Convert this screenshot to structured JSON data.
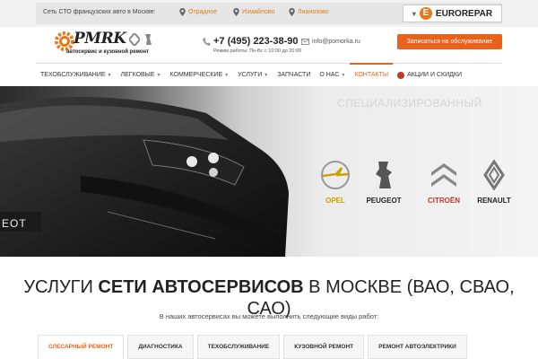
{
  "topbar": {
    "network_text": "Сеть СТО французских авто в Москве:",
    "locations": [
      "Отрадное",
      "Измайлово",
      "Лианозово"
    ],
    "partner": "EUROREPAR",
    "partner_letter": "E"
  },
  "header": {
    "logo_name": "PMRK",
    "logo_sub": "автосервис и кузовной ремонт",
    "phone": "+7 (495) 223-38-90",
    "hours": "Режим работы: Пн-Вс с 10:00 до 20:00",
    "email": "info@pomorka.ru",
    "signup_button": "Записаться на обслуживание"
  },
  "nav": {
    "items": [
      {
        "label": "ТЕХОБСЛУЖИВАНИЕ",
        "dropdown": true
      },
      {
        "label": "ЛЕГКОВЫЕ",
        "dropdown": true
      },
      {
        "label": "КОММЕРЧЕСКИЕ",
        "dropdown": true
      },
      {
        "label": "УСЛУГИ",
        "dropdown": true
      },
      {
        "label": "ЗАПЧАСТИ",
        "dropdown": false
      },
      {
        "label": "О НАС",
        "dropdown": true
      },
      {
        "label": "КОНТАКТЫ",
        "dropdown": false
      }
    ],
    "promo": "АКЦИИ И СКИДКИ",
    "active_index": 6
  },
  "hero": {
    "caption": "СПЕЦИАЛИЗИРОВАННЫЙ",
    "car_badge": "EOT",
    "brands": [
      "OPEL",
      "PEUGEOT",
      "CITROËN",
      "RENAULT"
    ]
  },
  "headline": {
    "part1": "УСЛУГИ ",
    "bold": "СЕТИ АВТОСЕРВИСОВ",
    "part2": " В МОСКВЕ (ВАО, СВАО, САО)"
  },
  "intro": "В наших автосервисах вы можете выполнить следующие виды работ:",
  "tabs": [
    "СЛЕСАРНЫЙ РЕМОНТ",
    "ДИАГНОСТИКА",
    "ТЕХОБСЛУЖИВАНИЕ",
    "КУЗОВНОЙ РЕМОНТ",
    "РЕМОНТ АВТОЭЛЕКТРИКИ"
  ],
  "colors": {
    "accent": "#e8621a",
    "text": "#333333",
    "opel": "#c9a100",
    "citroen": "#c0392b"
  }
}
